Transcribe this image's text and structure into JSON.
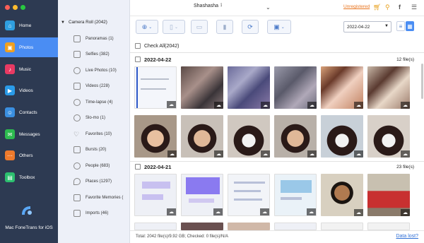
{
  "sidebar": {
    "items": [
      {
        "label": "Home",
        "icon": "home-icon",
        "color": "#2f9fe0"
      },
      {
        "label": "Photos",
        "icon": "photos-icon",
        "color": "#f0a020"
      },
      {
        "label": "Music",
        "icon": "music-icon",
        "color": "#e83a63"
      },
      {
        "label": "Videos",
        "icon": "videos-icon",
        "color": "#2a9be8"
      },
      {
        "label": "Contacts",
        "icon": "contacts-icon",
        "color": "#3a8fe0"
      },
      {
        "label": "Messages",
        "icon": "messages-icon",
        "color": "#2dbb4f"
      },
      {
        "label": "Others",
        "icon": "others-icon",
        "color": "#ee7a2c"
      },
      {
        "label": "Toolbox",
        "icon": "toolbox-icon",
        "color": "#2cbf6f"
      }
    ],
    "active_index": 1,
    "brand": "Mac FoneTrans for iOS"
  },
  "albums": {
    "root": "Camera Roll (2042)",
    "items": [
      {
        "label": "Panoramas (1)"
      },
      {
        "label": "Selfies (382)"
      },
      {
        "label": "Live Photos (10)"
      },
      {
        "label": "Videos (228)"
      },
      {
        "label": "Time-lapse (4)"
      },
      {
        "label": "Slo-mo (1)"
      },
      {
        "label": "Favorites (10)"
      },
      {
        "label": "Bursts (20)"
      },
      {
        "label": "People (683)"
      },
      {
        "label": "Places (1297)"
      },
      {
        "label": "Favorite Memories ("
      },
      {
        "label": "Imports (46)"
      }
    ]
  },
  "topbar": {
    "device_name": "Shashasha",
    "unregistered": "Unregistered"
  },
  "toolbar": {
    "date_value": "2022-04-22"
  },
  "content": {
    "check_all": "Check All(2042)",
    "groups": [
      {
        "date": "2022-04-22",
        "count": "12 file(s)"
      },
      {
        "date": "2022-04-21",
        "count": "23 file(s)"
      }
    ]
  },
  "status": {
    "text": "Total: 2042 file(s)/9.92 GB; Checked: 0 file(s)/N/A",
    "data_lost": "Data lost?"
  },
  "colors": {
    "sidebar_bg": "#2d3a52",
    "active": "#4a8df3",
    "accent_orange": "#e8731c",
    "link_blue": "#2f6fd6"
  }
}
